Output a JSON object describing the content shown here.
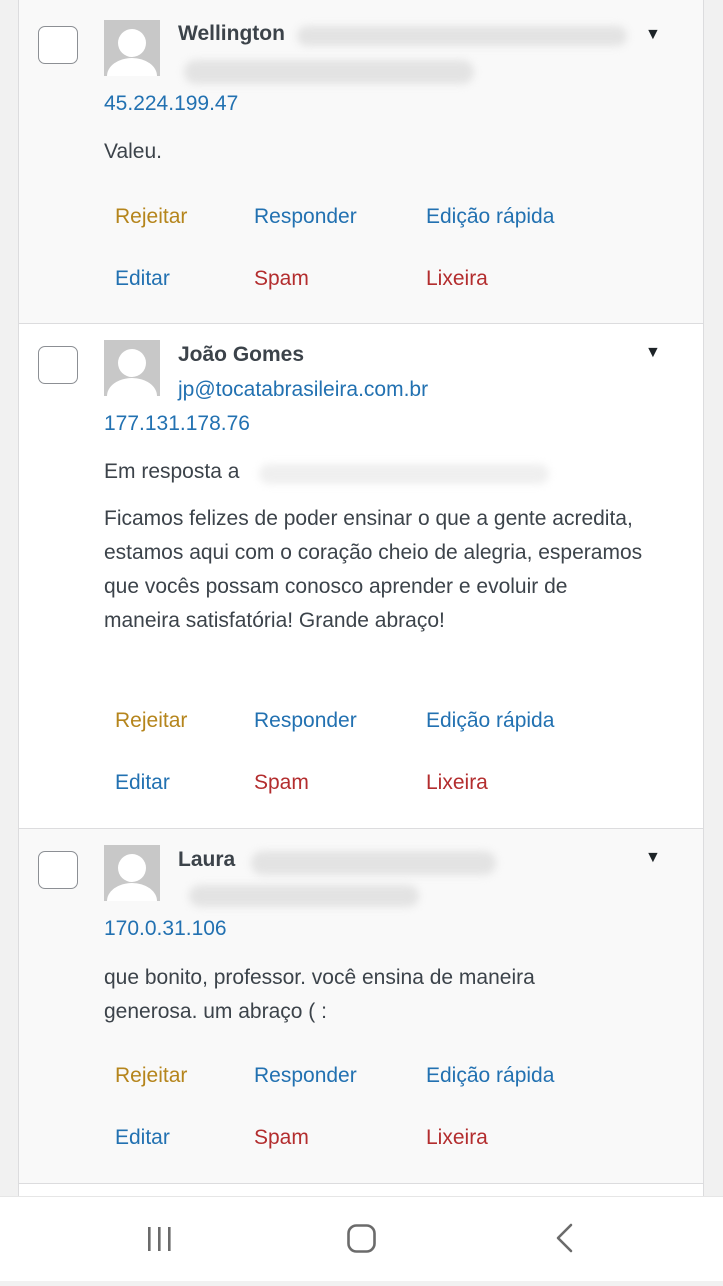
{
  "comments": [
    {
      "author": "Wellington",
      "email": "",
      "ip": "45.224.199.47",
      "in_reply_to": "",
      "text": "Valeu.",
      "actions": {
        "reject": "Rejeitar",
        "reply": "Responder",
        "quick_edit": "Edição rápida",
        "edit": "Editar",
        "spam": "Spam",
        "trash": "Lixeira"
      }
    },
    {
      "author": "João Gomes",
      "email": "jp@tocatabrasileira.com.br",
      "ip": "177.131.178.76",
      "in_reply_to": "Em resposta a",
      "text": "Ficamos felizes de poder ensinar o que a gente acredita, estamos aqui com o coração cheio de alegria, esperamos que vocês possam conosco aprender e evoluir de maneira satisfatória! Grande abraço!",
      "actions": {
        "reject": "Rejeitar",
        "reply": "Responder",
        "quick_edit": "Edição rápida",
        "edit": "Editar",
        "spam": "Spam",
        "trash": "Lixeira"
      }
    },
    {
      "author": "Laura",
      "email": "",
      "ip": "170.0.31.106",
      "in_reply_to": "",
      "text": "que bonito, professor. você ensina de maneira generosa. um abraço ( :",
      "actions": {
        "reject": "Rejeitar",
        "reply": "Responder",
        "quick_edit": "Edição rápida",
        "edit": "Editar",
        "spam": "Spam",
        "trash": "Lixeira"
      }
    }
  ],
  "icons": {
    "toggle": "triangle-down-icon",
    "nav_recent": "recent-apps-icon",
    "nav_home": "home-icon",
    "nav_back": "back-icon"
  }
}
